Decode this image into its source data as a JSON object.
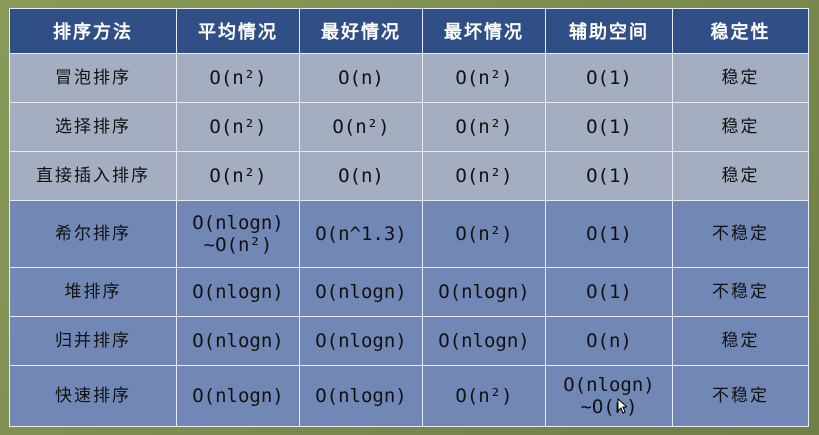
{
  "headers": [
    "排序方法",
    "平均情况",
    "最好情况",
    "最坏情况",
    "辅助空间",
    "稳定性"
  ],
  "rows": [
    {
      "name": "冒泡排序",
      "avg": "O(n²)",
      "best": "O(n)",
      "worst": "O(n²)",
      "space": "O(1)",
      "stability": "稳定"
    },
    {
      "name": "选择排序",
      "avg": "O(n²)",
      "best": "O(n²)",
      "worst": "O(n²)",
      "space": "O(1)",
      "stability": "稳定"
    },
    {
      "name": "直接插入排序",
      "avg": "O(n²)",
      "best": "O(n)",
      "worst": "O(n²)",
      "space": "O(1)",
      "stability": "稳定"
    },
    {
      "name": "希尔排序",
      "avg_line1": "O(nlogn)",
      "avg_line2": "~O(n²)",
      "best": "O(n^1.3)",
      "worst": "O(n²)",
      "space": "O(1)",
      "stability": "不稳定"
    },
    {
      "name": "堆排序",
      "avg": "O(nlogn)",
      "best": "O(nlogn)",
      "worst": "O(nlogn)",
      "space": "O(1)",
      "stability": "不稳定"
    },
    {
      "name": "归并排序",
      "avg": "O(nlogn)",
      "best": "O(nlogn)",
      "worst": "O(nlogn)",
      "space": "O(n)",
      "stability": "稳定"
    },
    {
      "name": "快速排序",
      "avg": "O(nlogn)",
      "best": "O(nlogn)",
      "worst": "O(n²)",
      "space_line1": "O(nlogn)",
      "space_line2": "~O(n)",
      "stability": "不稳定"
    }
  ],
  "colors": {
    "header_bg": "#2f4f86",
    "row_gray": "#a4aec0",
    "row_blue": "#7188b6",
    "background": "#7a8a4e"
  },
  "icons": [
    "mouse-cursor-icon"
  ]
}
